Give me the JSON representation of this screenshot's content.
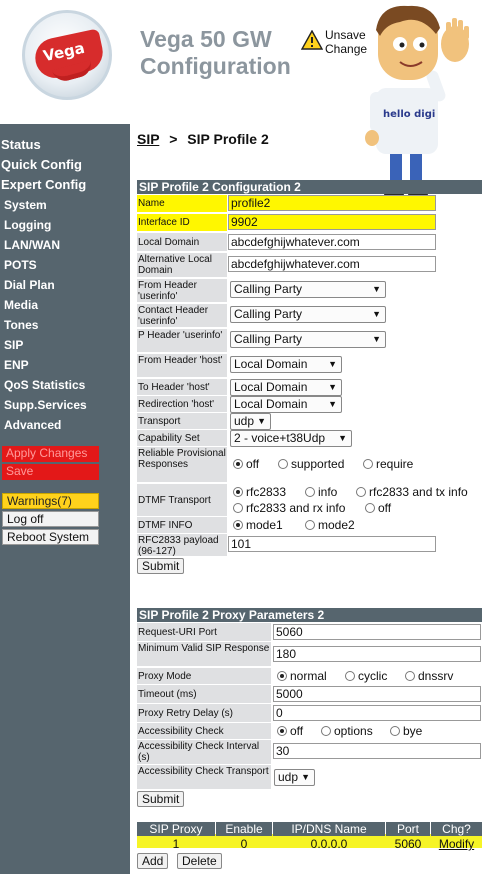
{
  "header": {
    "title": "Vega 50 GW Configuration",
    "logo_text": "Vega",
    "warning_text": "Unsave\nChange",
    "mascot_shirt": "hello digi"
  },
  "sidebar": {
    "items": [
      "Status",
      "Quick Config",
      "Expert Config",
      "System",
      "Logging",
      "LAN/WAN",
      "POTS",
      "Dial Plan",
      "Media",
      "Tones",
      "SIP",
      "ENP",
      "QoS Statistics",
      "Supp.Services",
      "Advanced"
    ],
    "apply": "Apply Changes",
    "save": "Save",
    "warnings": "Warnings(7)",
    "logoff": "Log off",
    "reboot": "Reboot System"
  },
  "breadcrumb": {
    "link": "SIP",
    "sep": ">",
    "current": "SIP Profile 2"
  },
  "config": {
    "title": "SIP Profile 2 Configuration 2",
    "name_label": "Name",
    "name_value": "profile2",
    "iface_label": "Interface ID",
    "iface_value": "9902",
    "local_domain_label": "Local Domain",
    "local_domain_value": "abcdefghijwhatever.com",
    "alt_domain_label": "Alternative Local Domain",
    "alt_domain_value": "abcdefghijwhatever.com",
    "from_userinfo_label": "From Header 'userinfo'",
    "from_userinfo_value": "Calling Party",
    "contact_userinfo_label": "Contact Header 'userinfo'",
    "contact_userinfo_value": "Calling Party",
    "p_userinfo_label": "P Header 'userinfo'",
    "p_userinfo_value": "Calling Party",
    "from_host_label": "From Header 'host'",
    "from_host_value": "Local Domain",
    "to_host_label": "To Header 'host'",
    "to_host_value": "Local Domain",
    "redir_host_label": "Redirection 'host'",
    "redir_host_value": "Local Domain",
    "transport_label": "Transport",
    "transport_value": "udp",
    "capability_label": "Capability Set",
    "capability_value": "2 - voice+t38Udp",
    "reliable_label": "Reliable Provisional Responses",
    "reliable_opts": [
      "off",
      "supported",
      "require"
    ],
    "dtmf_label": "DTMF Transport",
    "dtmf_opts": [
      "rfc2833",
      "info",
      "rfc2833 and tx info",
      "rfc2833 and rx info",
      "off"
    ],
    "dtmf_info_label": "DTMF INFO",
    "dtmf_info_opts": [
      "mode1",
      "mode2"
    ],
    "payload_label": "RFC2833 payload (96-127)",
    "payload_value": "101",
    "submit": "Submit"
  },
  "proxy": {
    "title": "SIP Profile 2 Proxy Parameters 2",
    "req_port_label": "Request-URI Port",
    "req_port_value": "5060",
    "min_resp_label": "Minimum Valid SIP Response",
    "min_resp_value": "180",
    "mode_label": "Proxy Mode",
    "mode_opts": [
      "normal",
      "cyclic",
      "dnssrv"
    ],
    "timeout_label": "Timeout (ms)",
    "timeout_value": "5000",
    "retry_label": "Proxy Retry Delay (s)",
    "retry_value": "0",
    "access_label": "Accessibility Check",
    "access_opts": [
      "off",
      "options",
      "bye"
    ],
    "interval_label": "Accessibility Check Interval (s)",
    "interval_value": "30",
    "access_transport_label": "Accessibility Check Transport",
    "access_transport_value": "udp",
    "submit": "Submit"
  },
  "table": {
    "headers": [
      "SIP Proxy",
      "Enable",
      "IP/DNS Name",
      "Port",
      "Chg?"
    ],
    "row": [
      "1",
      "0",
      "0.0.0.0",
      "5060",
      "Modify"
    ],
    "add": "Add",
    "delete": "Delete"
  },
  "colors": {
    "sidebar": "#56656e",
    "highlight": "#fff700",
    "apply": "#e31818"
  }
}
